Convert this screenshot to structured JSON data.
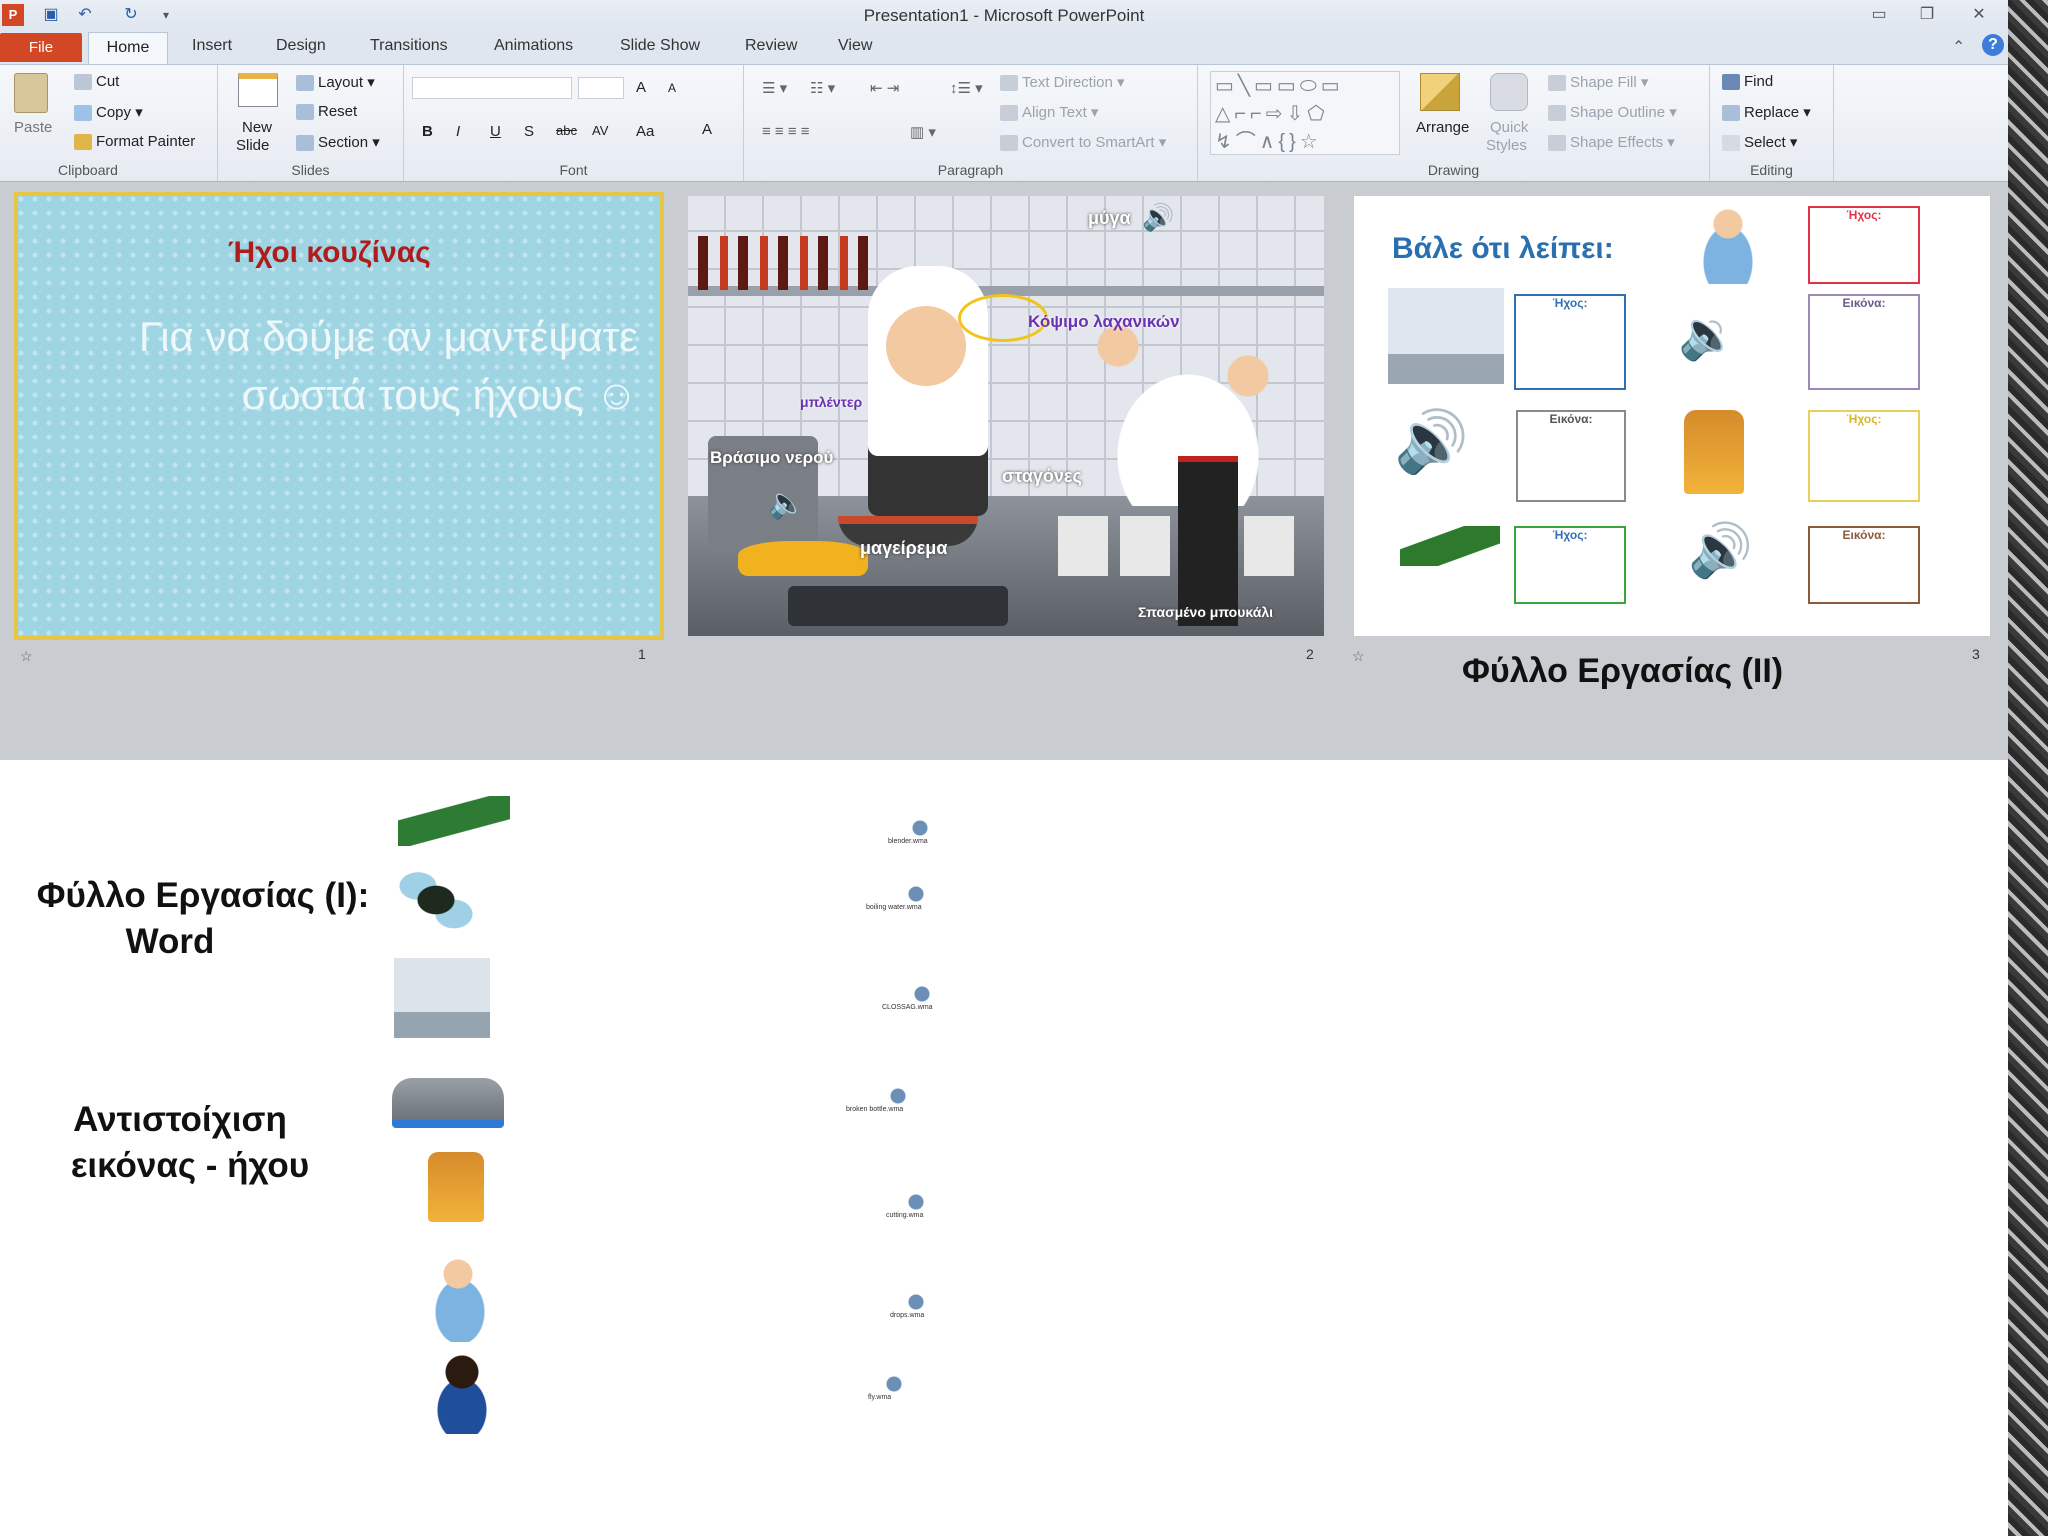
{
  "window": {
    "title": "Presentation1 - Microsoft PowerPoint"
  },
  "tabs": [
    "File",
    "Home",
    "Insert",
    "Design",
    "Transitions",
    "Animations",
    "Slide Show",
    "Review",
    "View"
  ],
  "ribbon": {
    "clipboard": {
      "label": "Clipboard",
      "paste": "Paste",
      "cut": "Cut",
      "copy": "Copy",
      "format_painter": "Format Painter"
    },
    "slides": {
      "label": "Slides",
      "new_slide_1": "New",
      "new_slide_2": "Slide",
      "layout": "Layout",
      "reset": "Reset",
      "section": "Section"
    },
    "font": {
      "label": "Font",
      "bold": "B",
      "italic": "I",
      "underline": "U",
      "strike": "S",
      "abc": "abc",
      "spacing": "AV",
      "case": "Aa",
      "color": "A",
      "grow": "A",
      "shrink": "A"
    },
    "paragraph": {
      "label": "Paragraph",
      "text_direction": "Text Direction",
      "align_text": "Align Text",
      "convert": "Convert to SmartArt"
    },
    "drawing": {
      "label": "Drawing",
      "arrange": "Arrange",
      "quick_styles_1": "Quick",
      "quick_styles_2": "Styles",
      "shape_fill": "Shape Fill",
      "shape_outline": "Shape Outline",
      "shape_effects": "Shape Effects"
    },
    "editing": {
      "label": "Editing",
      "find": "Find",
      "replace": "Replace",
      "select": "Select"
    }
  },
  "slides": {
    "s1": {
      "num": "1",
      "title": "Ήχοι κουζίνας",
      "body": "Για να δούμε αν μαντέψατε σωστά τους ήχους ☺"
    },
    "s2": {
      "num": "2",
      "labels": {
        "fly": "μύγα",
        "veg": "Κόψιμο λαχανικών",
        "blender": "μπλέντερ",
        "boil": "Βράσιμο νερού",
        "drops": "σταγόνες",
        "cook": "μαγείρεμα",
        "bottle": "Σπασμένο μπουκάλι"
      }
    },
    "s3": {
      "num": "3",
      "title": "Βάλε ότι λείπει:",
      "caption": "Φύλλο Εργασίας (ΙΙ)",
      "sound": "Ήχος:",
      "image": "Εικόνα:"
    }
  },
  "lower": {
    "worksheet": "Φύλλο Εργασίας (Ι):",
    "word": "Word",
    "match_1": "Αντιστοίχιση",
    "match_2": "εικόνας - ήχου",
    "captions": [
      "blender.wma",
      "boiling water.wma",
      "CLOSSAG.wma",
      "broken bottle.wma",
      "cutting.wma",
      "drops.wma",
      "fly.wma"
    ]
  },
  "colors": {
    "file_tab": "#d24726",
    "slide1_bg": "#9fd4e2",
    "title_red": "#b01c1c",
    "s3_title": "#2a6fb0"
  }
}
